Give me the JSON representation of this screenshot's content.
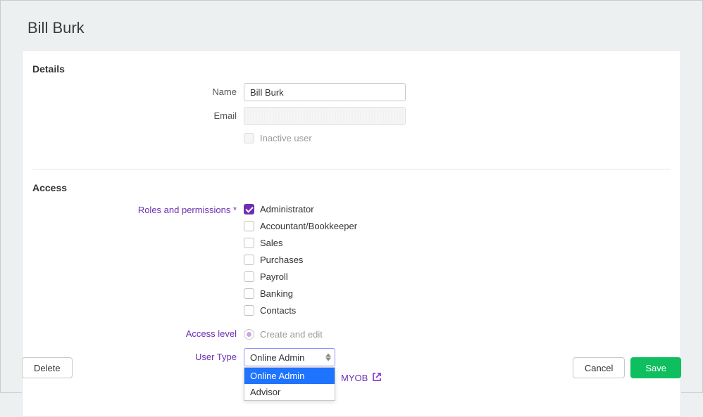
{
  "pageTitle": "Bill Burk",
  "sections": {
    "details": "Details",
    "access": "Access"
  },
  "fields": {
    "nameLabel": "Name",
    "nameValue": "Bill Burk",
    "emailLabel": "Email",
    "inactiveLabel": "Inactive user",
    "rolesLabel": "Roles and permissions",
    "accessLevelLabel": "Access level",
    "accessLevelValue": "Create and edit",
    "userTypeLabel": "User Type",
    "userTypeValue": "Online Admin"
  },
  "roles": [
    {
      "label": "Administrator",
      "checked": true
    },
    {
      "label": "Accountant/Bookkeeper",
      "checked": false
    },
    {
      "label": "Sales",
      "checked": false
    },
    {
      "label": "Purchases",
      "checked": false
    },
    {
      "label": "Payroll",
      "checked": false
    },
    {
      "label": "Banking",
      "checked": false
    },
    {
      "label": "Contacts",
      "checked": false
    }
  ],
  "userTypeOptions": [
    {
      "label": "Online Admin",
      "selected": true
    },
    {
      "label": "Advisor",
      "selected": false
    }
  ],
  "learnLink": {
    "prefix": "",
    "text": "MYOB"
  },
  "buttons": {
    "delete": "Delete",
    "cancel": "Cancel",
    "save": "Save"
  }
}
